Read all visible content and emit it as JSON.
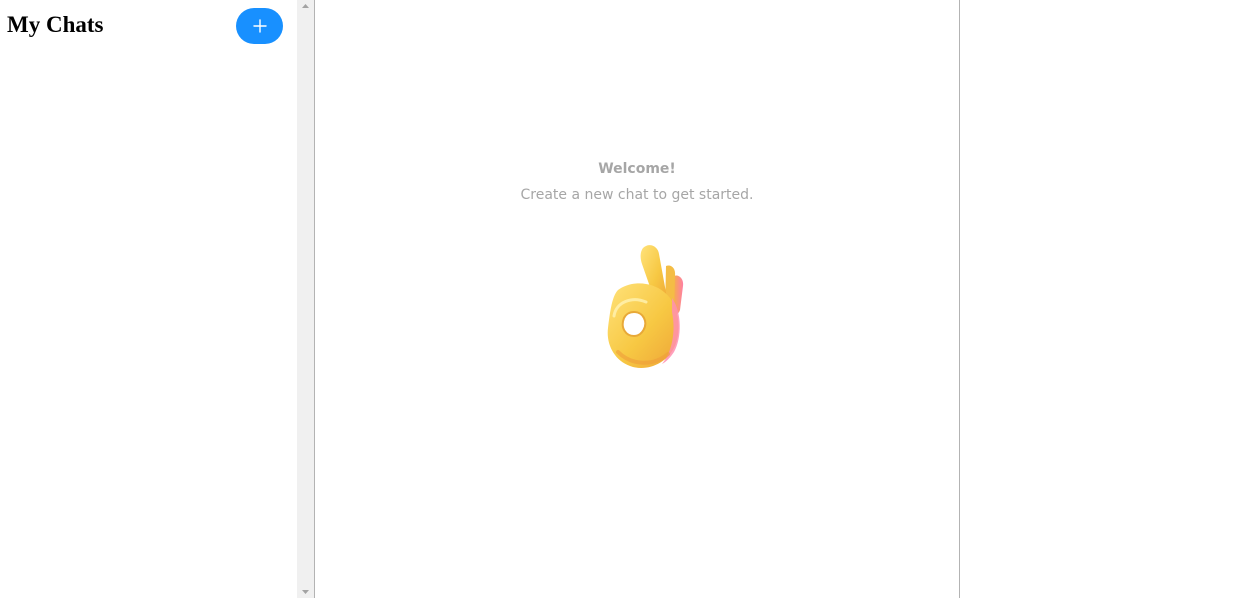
{
  "sidebar": {
    "title": "My Chats",
    "new_chat_icon": "plus-icon",
    "new_chat_color": "#1890ff"
  },
  "chat": {
    "welcome_title": "Welcome!",
    "welcome_subtitle": "Create a new chat to get started.",
    "illustration": "ok-hand-emoji"
  },
  "colors": {
    "accent": "#1890ff",
    "muted_text": "#a6a6a6",
    "divider": "#b3b3b3",
    "scrollbar": "#f0f0f0"
  }
}
